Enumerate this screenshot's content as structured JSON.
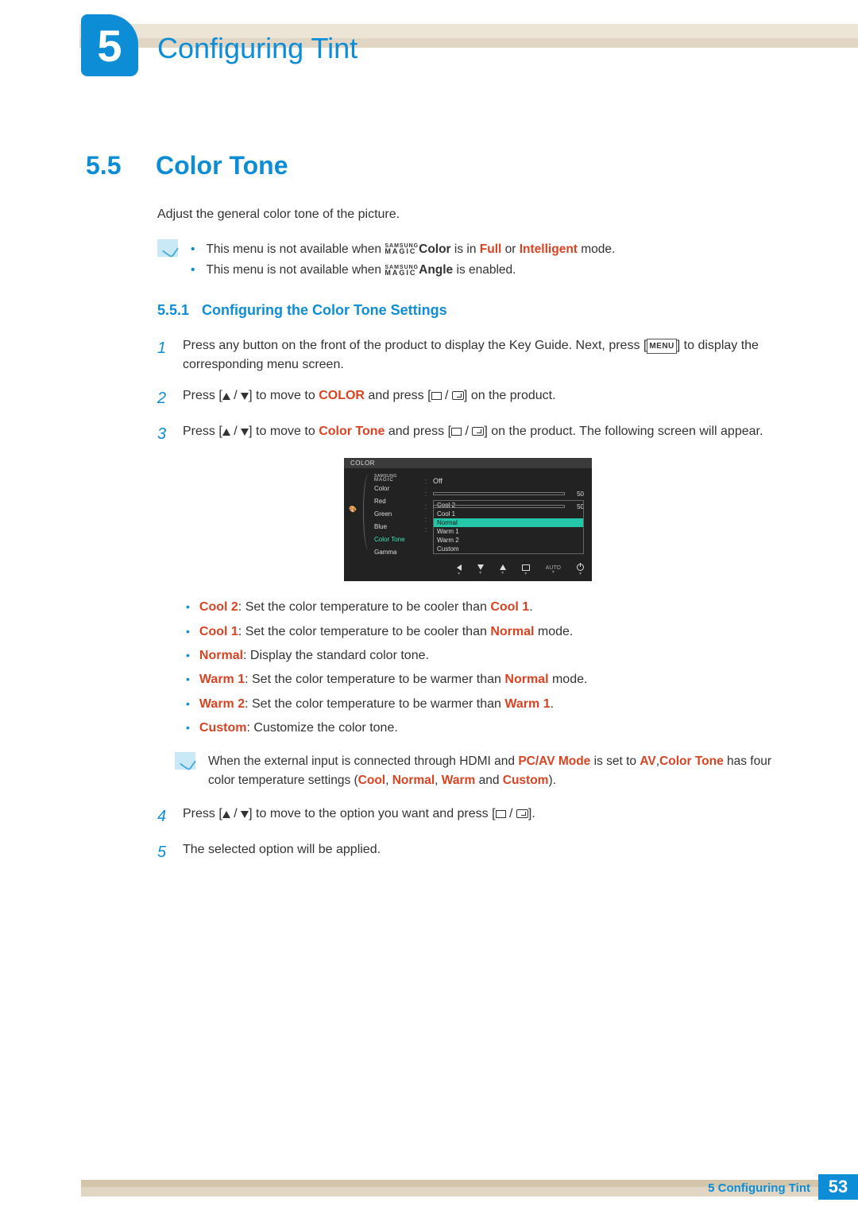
{
  "header": {
    "chapter_number": "5",
    "chapter_title": "Configuring Tint"
  },
  "section": {
    "number": "5.5",
    "title": "Color Tone"
  },
  "intro": "Adjust the general color tone of the picture.",
  "notes": {
    "line1_pre": "This menu is not available when ",
    "line1_brand1": "SAMSUNG",
    "line1_brand2": "MAGIC",
    "line1_mid": "Color",
    "line1_aft": " is in ",
    "line1_mode1": "Full",
    "line1_or": " or ",
    "line1_mode2": "Intelligent",
    "line1_end": " mode.",
    "line2_pre": "This menu is not available when ",
    "line2_mid": "Angle",
    "line2_end": " is enabled."
  },
  "subsection": {
    "number": "5.5.1",
    "title": "Configuring the Color Tone Settings"
  },
  "steps": {
    "s1": {
      "num": "1",
      "a": "Press any button on the front of the product to display the Key Guide. Next, press [",
      "menu": "MENU",
      "b": "] to display the corresponding menu screen."
    },
    "s2": {
      "num": "2",
      "a": "Press [",
      "b": "] to move to ",
      "target": "COLOR",
      "c": " and press [",
      "d": "] on the product."
    },
    "s3": {
      "num": "3",
      "a": "Press [",
      "b": "] to move to ",
      "target": "Color Tone",
      "c": " and press [",
      "d": "] on the product. The following screen will appear."
    },
    "s4": {
      "num": "4",
      "a": "Press [",
      "b": "] to move to the option you want and press [",
      "c": "]."
    },
    "s5": {
      "num": "5",
      "text": "The selected option will be applied."
    }
  },
  "osd": {
    "title": "COLOR",
    "magic_s": "SAMSUNG",
    "magic_m": "MAGIC",
    "magic_suffix": " Color",
    "items": {
      "red": "Red",
      "green": "Green",
      "blue": "Blue",
      "colortone": "Color Tone",
      "gamma": "Gamma"
    },
    "off": "Off",
    "val50a": "50",
    "val50b": "50",
    "options": {
      "cool2": "Cool 2",
      "cool1": "Cool 1",
      "normal": "Normal",
      "warm1": "Warm 1",
      "warm2": "Warm 2",
      "custom": "Custom"
    },
    "auto": "AUTO"
  },
  "descriptions": {
    "cool2": {
      "label": "Cool 2",
      "a": ": Set the color temperature to be cooler than ",
      "ref": "Cool 1",
      "b": "."
    },
    "cool1": {
      "label": "Cool 1",
      "a": ": Set the color temperature to be cooler than ",
      "ref": "Normal",
      "b": " mode."
    },
    "normal": {
      "label": "Normal",
      "a": ": Display the standard color tone."
    },
    "warm1": {
      "label": "Warm 1",
      "a": ": Set the color temperature to be warmer than ",
      "ref": "Normal",
      "b": " mode."
    },
    "warm2": {
      "label": "Warm 2",
      "a": ": Set the color temperature to be warmer than ",
      "ref": "Warm 1",
      "b": "."
    },
    "custom": {
      "label": "Custom",
      "a": ": Customize the color tone."
    }
  },
  "inner_note": {
    "a": "When the external input is connected through HDMI and ",
    "pcav": "PC/AV Mode",
    "b": " is set to ",
    "av": "AV",
    "c": ",",
    "ct": "Color Tone",
    "d": " has four color temperature settings (",
    "cool": "Cool",
    "comma1": ", ",
    "normal": "Normal",
    "comma2": ", ",
    "warm": "Warm",
    "and": " and ",
    "custom": "Custom",
    "e": ")."
  },
  "slash": " / ",
  "footer": {
    "label_num": "5",
    "label_text": " Configuring Tint",
    "page": "53"
  }
}
